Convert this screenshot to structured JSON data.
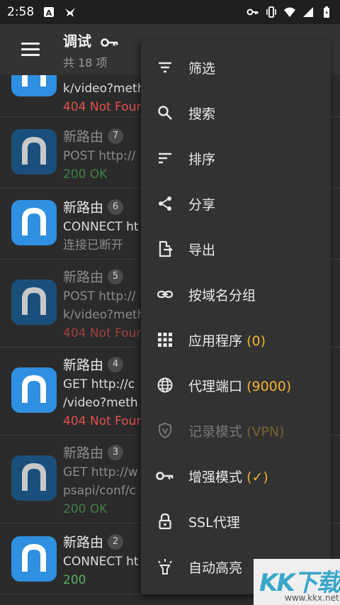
{
  "status_bar": {
    "time": "2:58"
  },
  "app_bar": {
    "title": "调试",
    "subtitle": "共 18 项"
  },
  "rows": [
    {
      "line1": "k/video?meth",
      "line2": "404 Not Foun"
    },
    {
      "title": "新路由",
      "badge": "7",
      "line1": "POST http://",
      "line2": "200 OK"
    },
    {
      "title": "新路由",
      "badge": "6",
      "line1": "CONNECT ht",
      "line2": "连接已断开"
    },
    {
      "title": "新路由",
      "badge": "5",
      "line1": "POST http://",
      "line2": "k/video?meth",
      "line3": "404 Not Foun"
    },
    {
      "title": "新路由",
      "badge": "4",
      "line1": "GET http://c",
      "line2": "/video?meth",
      "line3": "404 Not Foun"
    },
    {
      "title": "新路由",
      "badge": "3",
      "line1": "GET http://w",
      "line2": "psapi/conf/c",
      "line3": "200 OK"
    },
    {
      "title": "新路由",
      "badge": "2",
      "line1": "CONNECT ht",
      "line2": "200"
    }
  ],
  "menu": {
    "filter": "筛选",
    "search": "搜索",
    "sort": "排序",
    "share": "分享",
    "export": "导出",
    "group_by_domain": "按域名分组",
    "apps": "应用程序",
    "apps_count": "(0)",
    "proxy_port": "代理端口",
    "proxy_port_value": "(9000)",
    "record_mode": "记录模式",
    "record_mode_value": "(VPN)",
    "enhanced_mode": "增强模式",
    "enhanced_mode_value": "(✓)",
    "ssl_proxy": "SSL代理",
    "auto_highlight": "自动高亮"
  },
  "watermark": {
    "big": "KK下载",
    "small": "www.kkx.net"
  },
  "colors": {
    "accent": "#f0b330",
    "error": "#e2504a",
    "success": "#59b05d",
    "app_icon": "#2f8fe0"
  }
}
